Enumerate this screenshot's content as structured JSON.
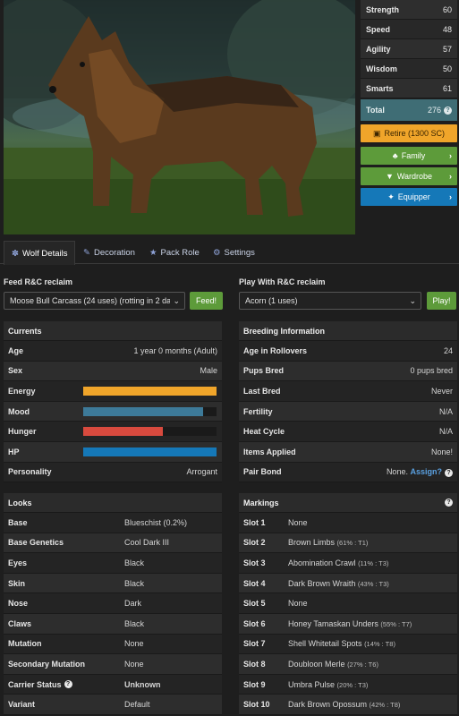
{
  "stats": {
    "rows": [
      {
        "label": "Strength",
        "value": "60"
      },
      {
        "label": "Speed",
        "value": "48"
      },
      {
        "label": "Agility",
        "value": "57"
      },
      {
        "label": "Wisdom",
        "value": "50"
      },
      {
        "label": "Smarts",
        "value": "61"
      }
    ],
    "total_label": "Total",
    "total_value": "276"
  },
  "actions": {
    "retire": "Retire (1300 SC)",
    "family": "Family",
    "wardrobe": "Wardrobe",
    "equipper": "Equipper"
  },
  "tabs": [
    "Wolf Details",
    "Decoration",
    "Pack Role",
    "Settings"
  ],
  "feed": {
    "label": "Feed R&C reclaim",
    "selected": "Moose Bull Carcass (24 uses) (rotting in 2 da",
    "button": "Feed!"
  },
  "play": {
    "label": "Play With R&C reclaim",
    "selected": "Acorn (1 uses)",
    "button": "Play!"
  },
  "currents": {
    "title": "Currents",
    "age_label": "Age",
    "age": "1 year 0 months (Adult)",
    "sex_label": "Sex",
    "sex": "Male",
    "energy_label": "Energy",
    "energy_level": 1.0,
    "energy_color": "#f0a52a",
    "mood_label": "Mood",
    "mood_level": 0.9,
    "mood_color": "#3d7a99",
    "hunger_label": "Hunger",
    "hunger_level": 0.6,
    "hunger_color": "#d84a3e",
    "hp_label": "HP",
    "hp_level": 1.0,
    "hp_color": "#1578b8",
    "personality_label": "Personality",
    "personality": "Arrogant"
  },
  "breeding": {
    "title": "Breeding Information",
    "rows": [
      {
        "label": "Age in Rollovers",
        "value": "24"
      },
      {
        "label": "Pups Bred",
        "value": "0 pups bred"
      },
      {
        "label": "Last Bred",
        "value": "Never"
      },
      {
        "label": "Fertility",
        "value": "N/A"
      },
      {
        "label": "Heat Cycle",
        "value": "N/A"
      },
      {
        "label": "Items Applied",
        "value": "None!"
      }
    ],
    "pair_bond_label": "Pair Bond",
    "pair_bond_value": "None.",
    "pair_bond_link": "Assign?"
  },
  "looks": {
    "title": "Looks",
    "rows": [
      {
        "label": "Base",
        "value": "Blueschist (0.2%)"
      },
      {
        "label": "Base Genetics",
        "value": "Cool Dark III"
      },
      {
        "label": "Eyes",
        "value": "Black"
      },
      {
        "label": "Skin",
        "value": "Black"
      },
      {
        "label": "Nose",
        "value": "Dark"
      },
      {
        "label": "Claws",
        "value": "Black"
      },
      {
        "label": "Mutation",
        "value": "None"
      },
      {
        "label": "Secondary Mutation",
        "value": "None"
      }
    ],
    "carrier_label": "Carrier Status",
    "carrier_value": "Unknown",
    "variant_label": "Variant",
    "variant_value": "Default"
  },
  "markings": {
    "title": "Markings",
    "slots": [
      {
        "slot": "Slot 1",
        "name": "None",
        "detail": ""
      },
      {
        "slot": "Slot 2",
        "name": "Brown Limbs",
        "detail": "(61% : T1)"
      },
      {
        "slot": "Slot 3",
        "name": "Abomination Crawl",
        "detail": "(11% : T3)"
      },
      {
        "slot": "Slot 4",
        "name": "Dark Brown Wraith",
        "detail": "(43% : T3)"
      },
      {
        "slot": "Slot 5",
        "name": "None",
        "detail": ""
      },
      {
        "slot": "Slot 6",
        "name": "Honey Tamaskan Unders",
        "detail": "(55% : T7)"
      },
      {
        "slot": "Slot 7",
        "name": "Shell Whitetail Spots",
        "detail": "(14% : T8)"
      },
      {
        "slot": "Slot 8",
        "name": "Doubloon Merle",
        "detail": "(27% : T6)"
      },
      {
        "slot": "Slot 9",
        "name": "Umbra Pulse",
        "detail": "(20% : T3)"
      },
      {
        "slot": "Slot 10",
        "name": "Dark Brown Opossum",
        "detail": "(42% : T8)"
      }
    ]
  }
}
